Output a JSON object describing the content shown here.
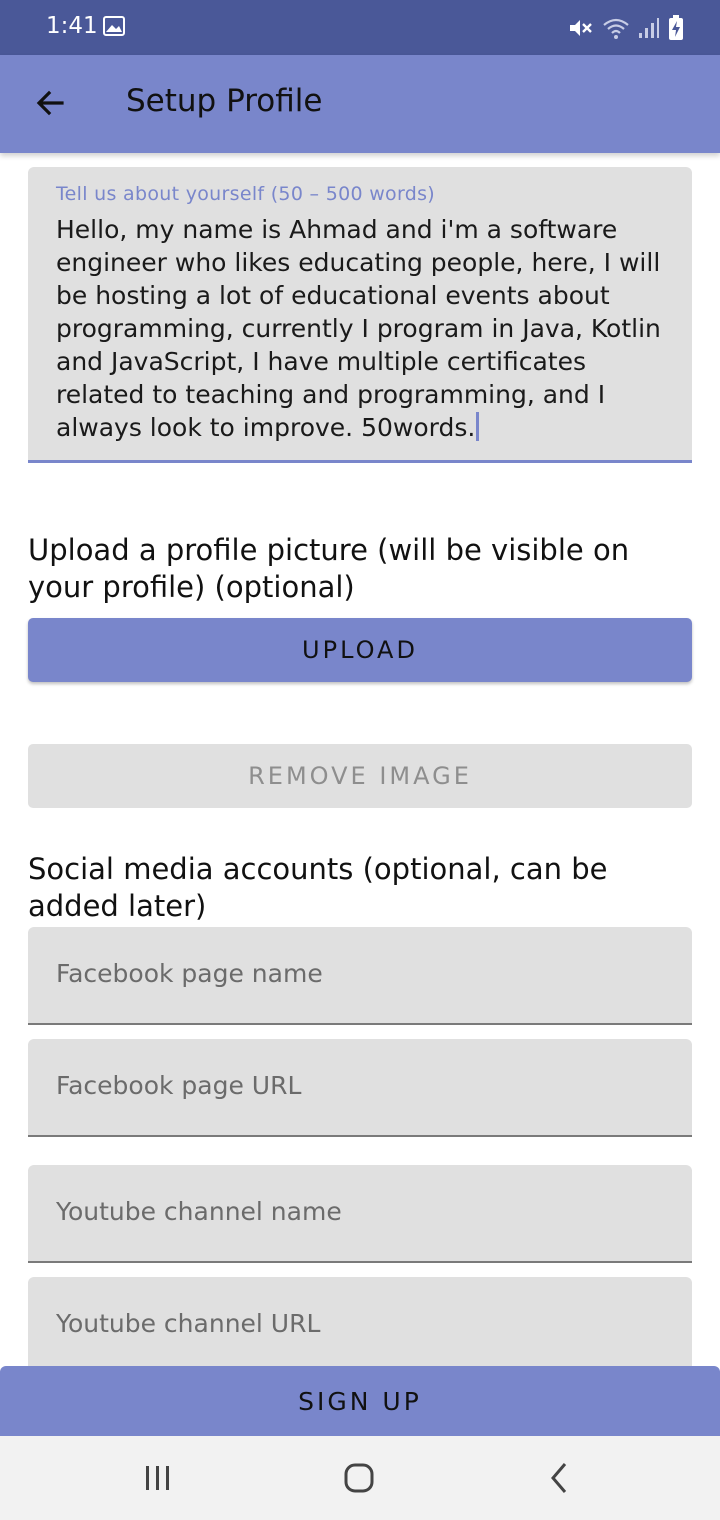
{
  "status_bar": {
    "time": "1:41"
  },
  "app_bar": {
    "title": "Setup Profile"
  },
  "about": {
    "label": "Tell us about yourself (50 – 500 words)",
    "value": "Hello, my name is Ahmad and i'm a software engineer who likes educating people, here, I will be hosting a lot of educational events about programming, currently I program in Java, Kotlin and JavaScript, I have multiple certificates related to teaching and programming, and I always look to improve. 50words."
  },
  "upload": {
    "heading": "Upload a profile picture (will be visible on your profile) (optional)",
    "upload_label": "UPLOAD",
    "remove_label": "REMOVE IMAGE"
  },
  "social": {
    "heading": "Social media accounts (optional, can be added later)",
    "facebook_name_placeholder": "Facebook page name",
    "facebook_url_placeholder": "Facebook page URL",
    "youtube_name_placeholder": "Youtube channel name",
    "youtube_url_placeholder": "Youtube channel URL"
  },
  "signup": {
    "label": "SIGN UP"
  },
  "icons": {
    "back": "arrow-back-icon",
    "gallery": "image-icon",
    "mute": "vibrate-mute-icon",
    "wifi": "wifi-icon",
    "signal": "signal-icon",
    "battery": "battery-charging-icon",
    "recents": "recents-icon",
    "home": "home-icon",
    "nav_back": "chevron-left-icon"
  },
  "colors": {
    "status_bar": "#4a5898",
    "primary": "#7986cb",
    "field_bg": "#e0e0e0",
    "nav_bar": "#f2f2f2"
  }
}
